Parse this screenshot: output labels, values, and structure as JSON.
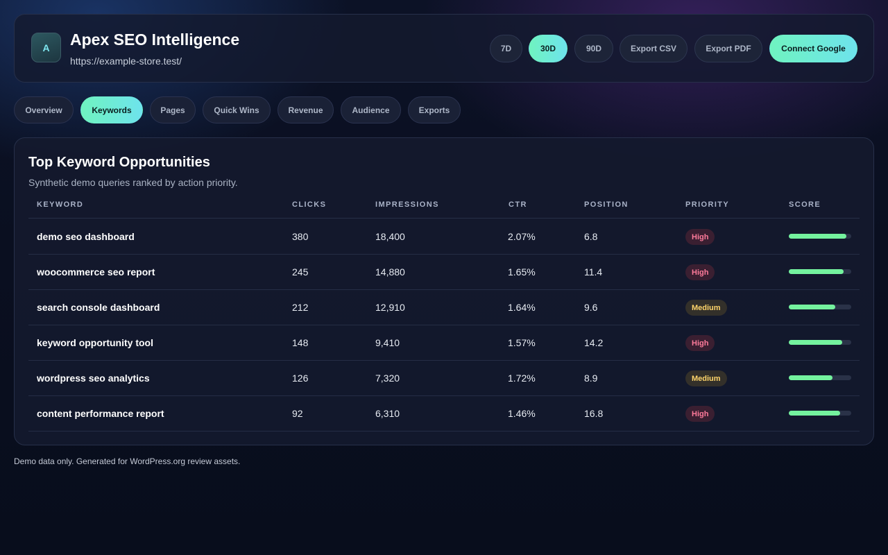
{
  "header": {
    "logo_letter": "A",
    "title": "Apex SEO Intelligence",
    "url": "https://example-store.test/",
    "buttons": {
      "range_7d": "7D",
      "range_30d": "30D",
      "range_90d": "90D",
      "export_csv": "Export CSV",
      "export_pdf": "Export PDF",
      "connect_google": "Connect Google"
    },
    "active_range": "30D"
  },
  "tabs": [
    "Overview",
    "Keywords",
    "Pages",
    "Quick Wins",
    "Revenue",
    "Audience",
    "Exports"
  ],
  "active_tab": "Keywords",
  "card": {
    "title": "Top Keyword Opportunities",
    "subtitle": "Synthetic demo queries ranked by action priority.",
    "columns": [
      "KEYWORD",
      "CLICKS",
      "IMPRESSIONS",
      "CTR",
      "POSITION",
      "PRIORITY",
      "SCORE"
    ],
    "rows": [
      {
        "keyword": "demo seo dashboard",
        "clicks": "380",
        "impressions": "18,400",
        "ctr": "2.07%",
        "position": "6.8",
        "priority": "High",
        "score": 0.92
      },
      {
        "keyword": "woocommerce seo report",
        "clicks": "245",
        "impressions": "14,880",
        "ctr": "1.65%",
        "position": "11.4",
        "priority": "High",
        "score": 0.88
      },
      {
        "keyword": "search console dashboard",
        "clicks": "212",
        "impressions": "12,910",
        "ctr": "1.64%",
        "position": "9.6",
        "priority": "Medium",
        "score": 0.74
      },
      {
        "keyword": "keyword opportunity tool",
        "clicks": "148",
        "impressions": "9,410",
        "ctr": "1.57%",
        "position": "14.2",
        "priority": "High",
        "score": 0.85
      },
      {
        "keyword": "wordpress seo analytics",
        "clicks": "126",
        "impressions": "7,320",
        "ctr": "1.72%",
        "position": "8.9",
        "priority": "Medium",
        "score": 0.7
      },
      {
        "keyword": "content performance report",
        "clicks": "92",
        "impressions": "6,310",
        "ctr": "1.46%",
        "position": "16.8",
        "priority": "High",
        "score": 0.82
      }
    ]
  },
  "footer": "Demo data only. Generated for WordPress.org review assets.",
  "colors": {
    "accent_gradient_start": "#6ff3c0",
    "accent_gradient_end": "#6ee3ec",
    "score_fill": "#74f29e",
    "priority_high": "#ff7b9b",
    "priority_medium": "#ffd56b"
  }
}
